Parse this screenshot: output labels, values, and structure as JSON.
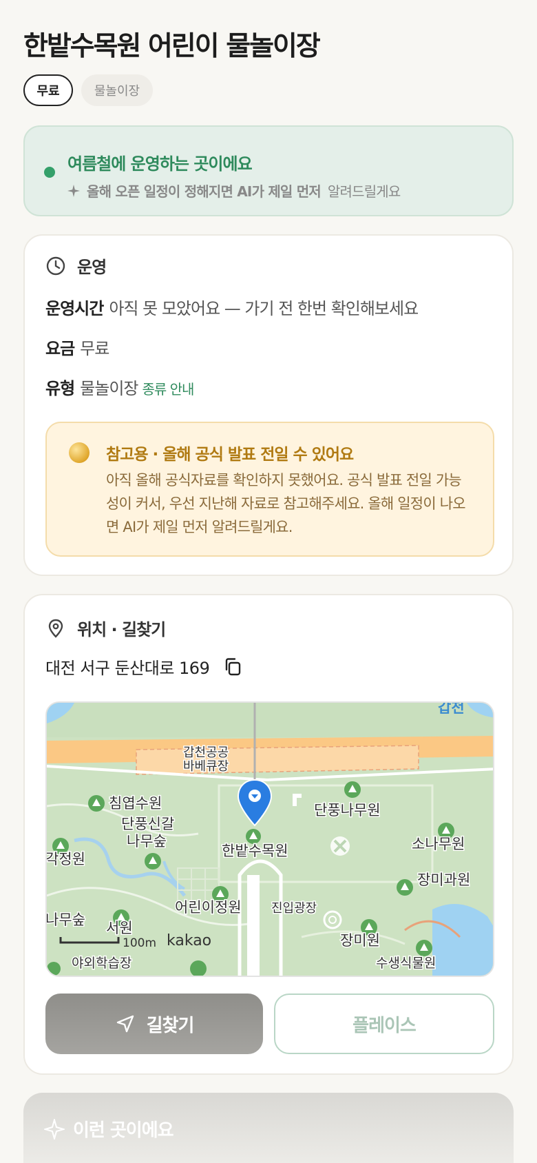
{
  "page": {
    "title": "한밭수목원 어린이 물놀이장",
    "chips": [
      "무료",
      "물놀이장"
    ]
  },
  "notice": {
    "title": "여름철에 운영하는 곳이에요",
    "sub_bold": "올해 오픈 일정이 정해지면 AI가 제일 먼저",
    "sub_rest": "알려드릴게요"
  },
  "operation": {
    "heading": "운영",
    "hours_label": "운영시간",
    "hours_value": "아직 못 모았어요 — 가기 전 한번 확인해보세요",
    "fee_label": "요금",
    "fee_value": "무료",
    "type_label": "유형",
    "type_value": "물놀이장",
    "type_link": "종류 안내",
    "warning_title": "참고용 · 올해 공식 발표 전일 수 있어요",
    "warning_body": "아직 올해 공식자료를 확인하지 못했어요. 공식 발표 전일 가능성이 커서, 우선 지난해 자료로 참고해주세요. 올해 일정이 나오면 AI가 제일 먼저 알려드릴게요."
  },
  "location": {
    "heading": "위치 · 길찾기",
    "address": "대전 서구 둔산대로 169",
    "map": {
      "labels": [
        "갑천공공",
        "바베큐장",
        "침엽수원",
        "단풍신갈",
        "나무숲",
        "각정원",
        "한밭수목원",
        "단풍나무원",
        "소나무원",
        "장미과원",
        "어린이정원",
        "진입광장",
        "나무숲",
        "서원",
        "장미원",
        "야외학습장",
        "수생식물원",
        "갑천"
      ],
      "scale": "100m",
      "brand": "kakao"
    },
    "route_button": "길찾기",
    "place_button": "플레이스"
  },
  "next_section": {
    "title": "이런 곳이에요"
  }
}
